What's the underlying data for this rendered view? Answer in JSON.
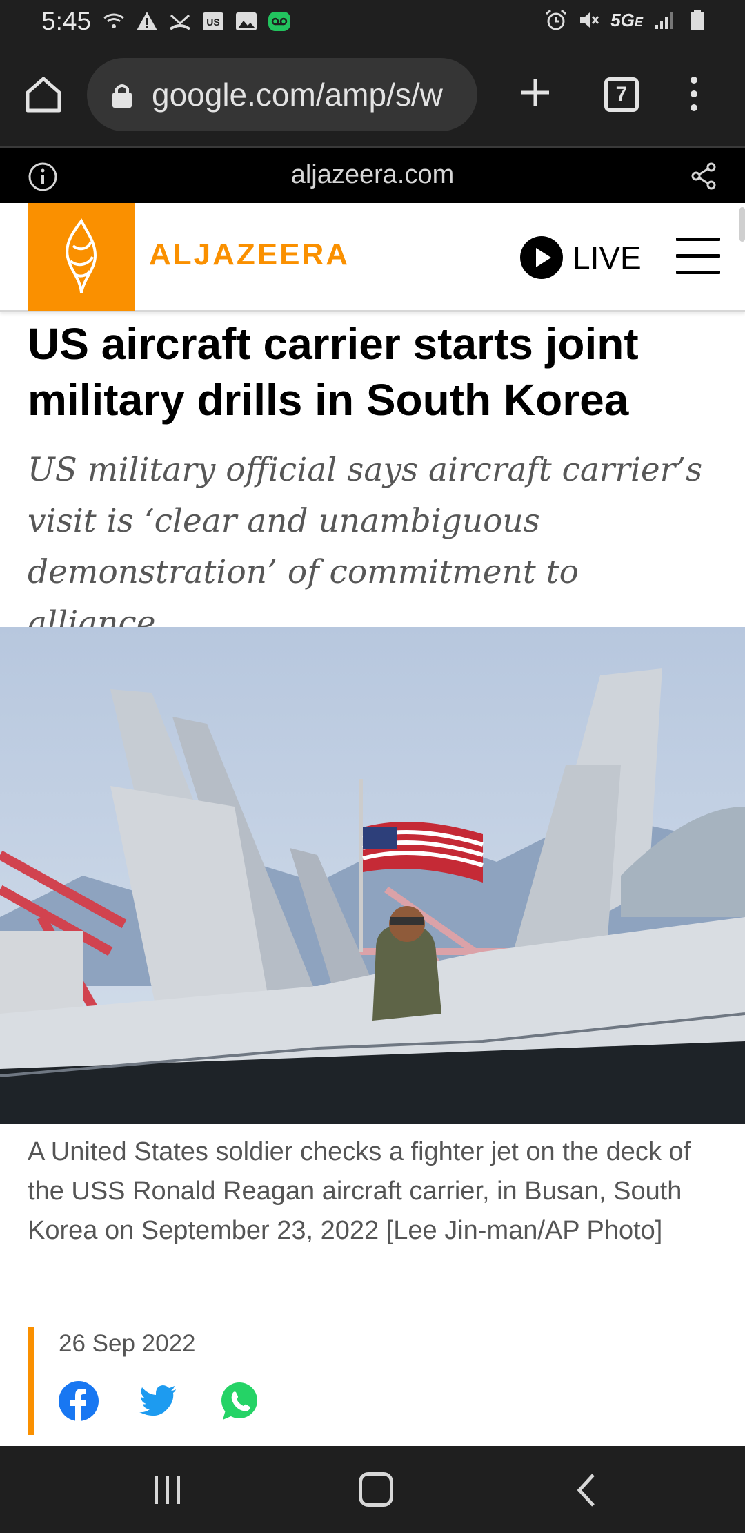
{
  "status_bar": {
    "time": "5:45",
    "network": "5G",
    "network_sub": "E",
    "left_icons": [
      "wifi-calling-icon",
      "alert-icon",
      "missed-call-icon",
      "us-badge-icon",
      "image-icon",
      "voicemail-icon"
    ],
    "right_icons": [
      "alarm-icon",
      "mute-icon",
      "signal-icon",
      "battery-icon"
    ]
  },
  "browser": {
    "url": "google.com/amp/s/w",
    "tab_count": "7"
  },
  "amp_bar": {
    "domain": "aljazeera.com"
  },
  "site_header": {
    "brand": "ALJAZEERA",
    "live_label": "LIVE",
    "brand_color": "#fa9000"
  },
  "article": {
    "headline": "US aircraft carrier starts joint military drills in South Korea",
    "subhead": "US military official says aircraft carrier’s visit is ‘clear and unambiguous demonstration’ of commitment to alliance.",
    "caption": "A United States soldier checks a fighter jet on the deck of the USS Ronald Reagan aircraft carrier, in Busan, South Korea on September 23, 2022 [Lee Jin-man/AP Photo]",
    "date": "26 Sep 2022",
    "share_icons": [
      "facebook-icon",
      "twitter-icon",
      "whatsapp-icon"
    ]
  }
}
